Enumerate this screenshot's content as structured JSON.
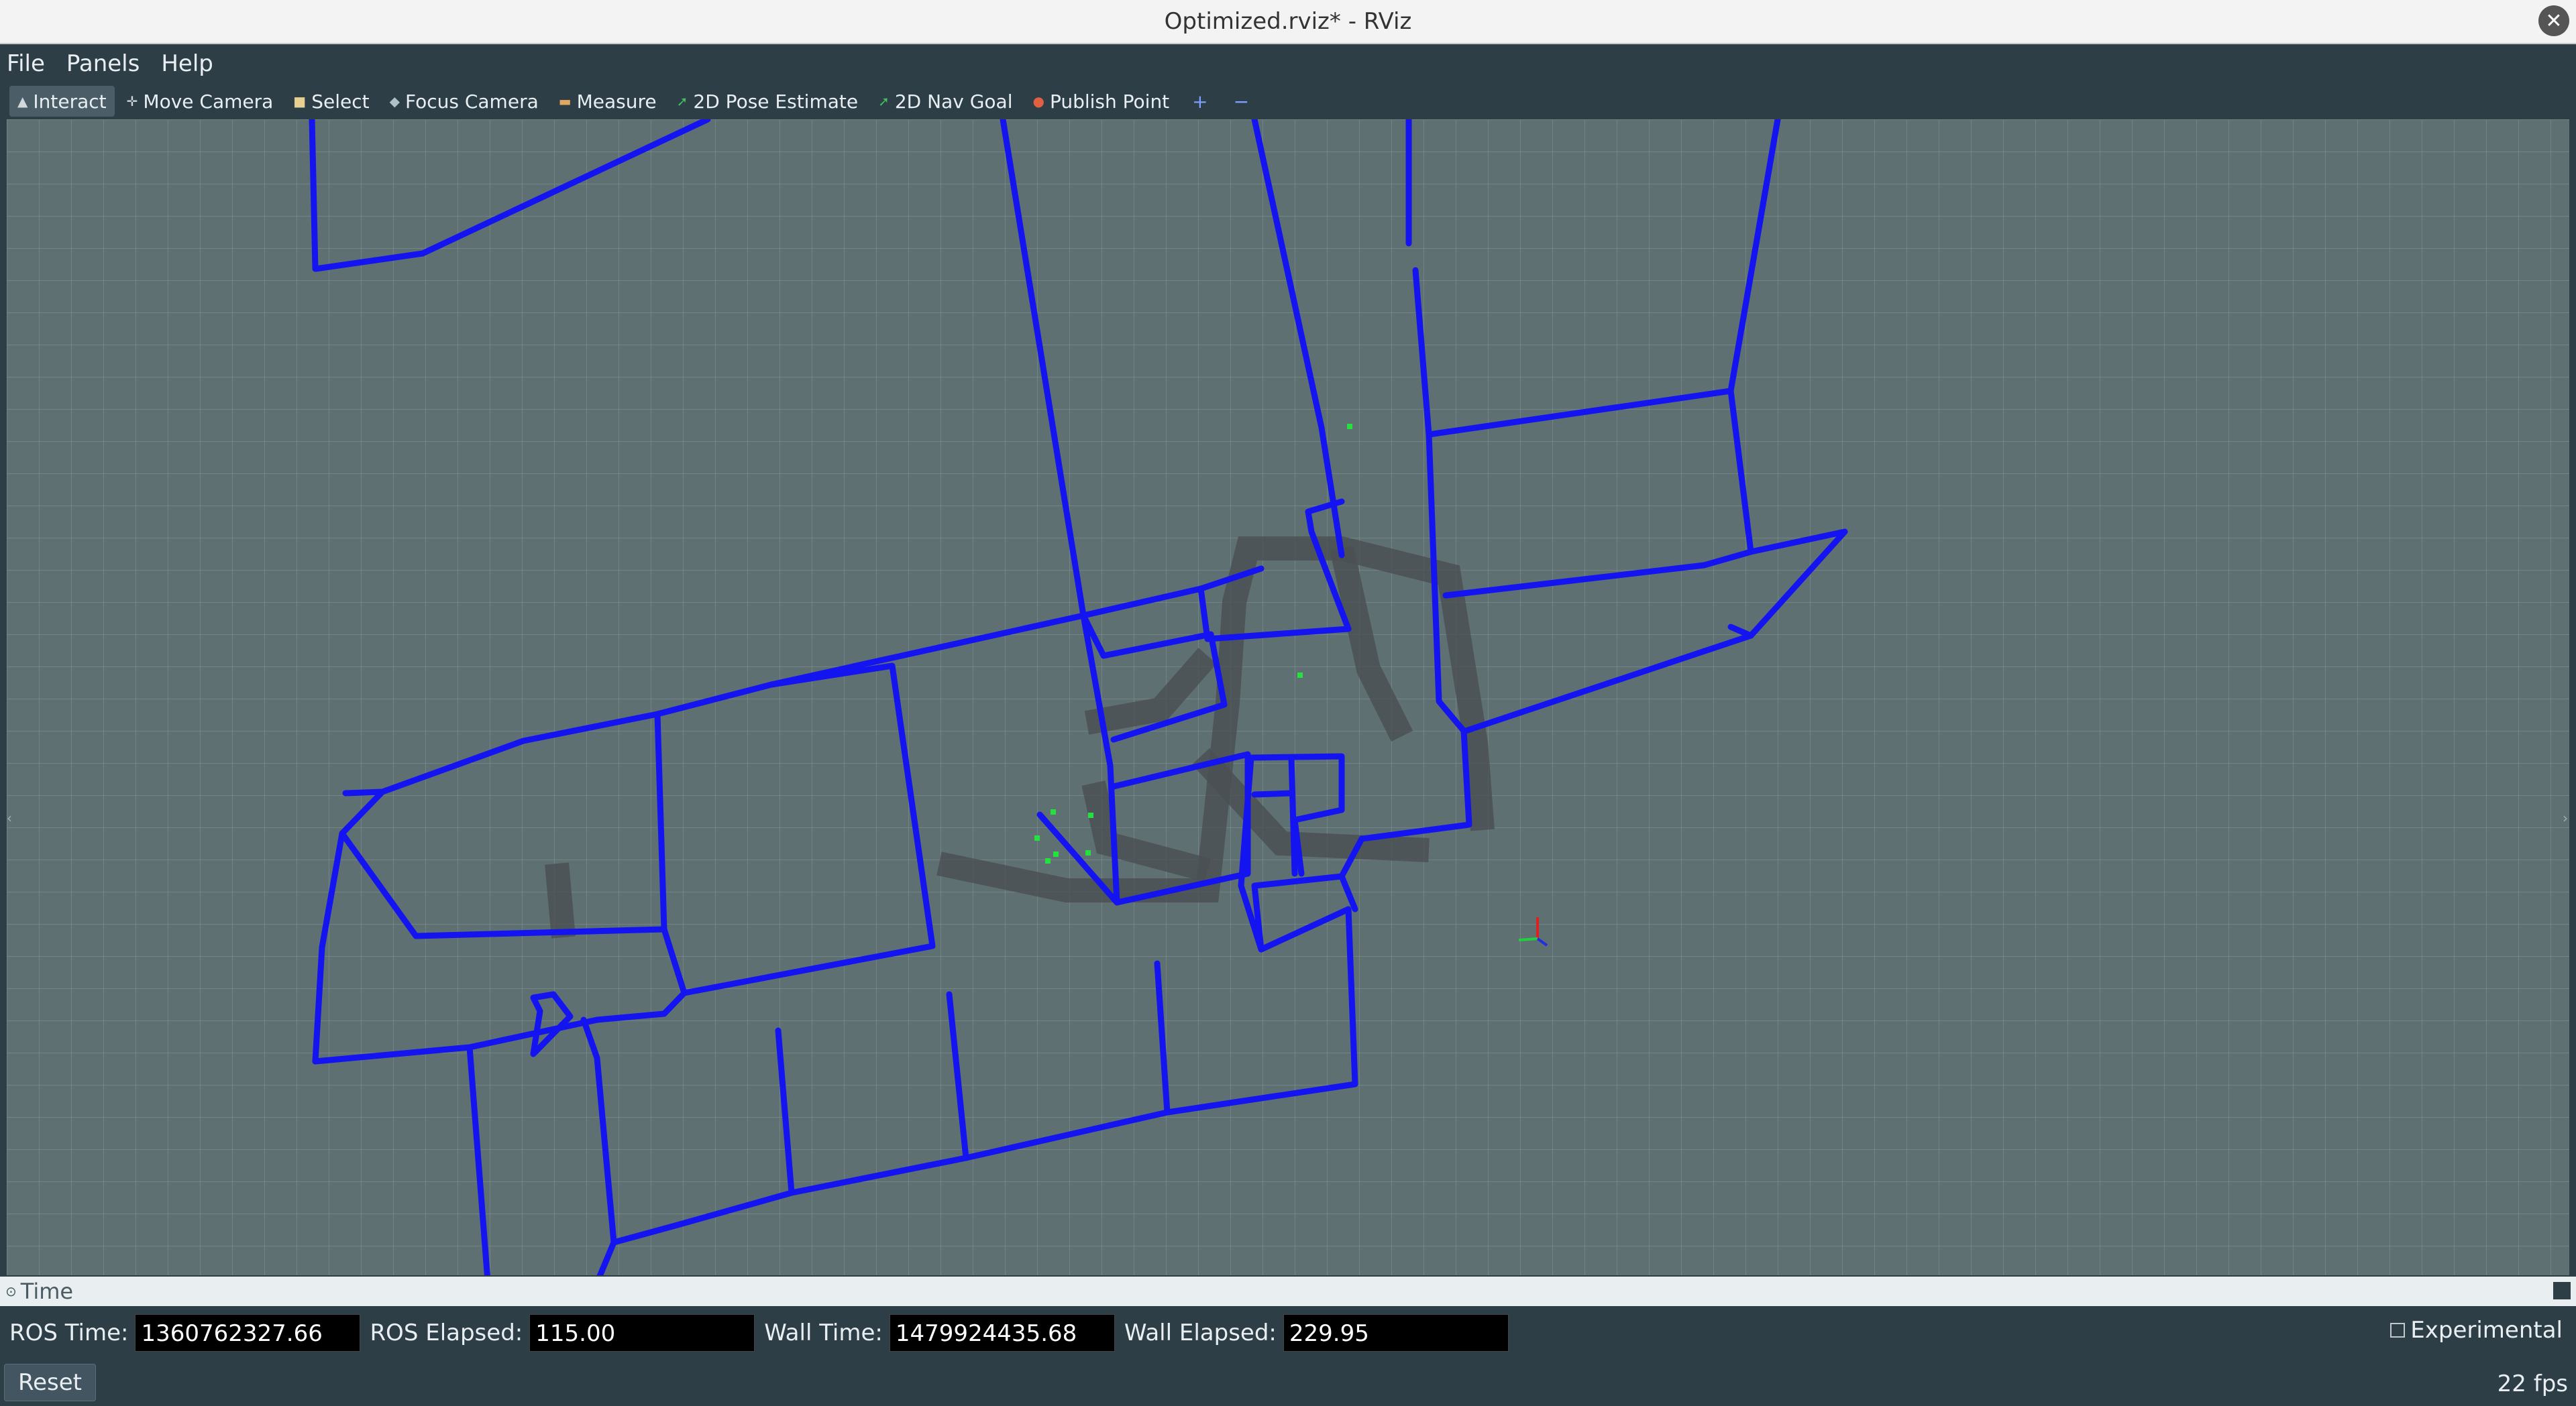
{
  "window": {
    "title": "Optimized.rviz* - RViz",
    "close_glyph": "✕"
  },
  "menu": [
    "File",
    "Panels",
    "Help"
  ],
  "toolbar": [
    {
      "label": "Interact",
      "icon": "interact-icon",
      "glyph": "▲",
      "color": "#d0d8dc",
      "active": true
    },
    {
      "label": "Move Camera",
      "icon": "move-camera-icon",
      "glyph": "✛",
      "color": "#d0d8dc"
    },
    {
      "label": "Select",
      "icon": "select-icon",
      "glyph": "■",
      "color": "#e8d090"
    },
    {
      "label": "Focus Camera",
      "icon": "focus-camera-icon",
      "glyph": "◆",
      "color": "#b0c0c8"
    },
    {
      "label": "Measure",
      "icon": "measure-icon",
      "glyph": "▬",
      "color": "#e0a860"
    },
    {
      "label": "2D Pose Estimate",
      "icon": "pose-estimate-icon",
      "glyph": "➚",
      "color": "#40c060"
    },
    {
      "label": "2D Nav Goal",
      "icon": "nav-goal-icon",
      "glyph": "➚",
      "color": "#40c060"
    },
    {
      "label": "Publish Point",
      "icon": "publish-point-icon",
      "glyph": "●",
      "color": "#e06040"
    }
  ],
  "toolbar_extra": {
    "add": "+",
    "remove": "−"
  },
  "colors": {
    "graph_edge": "#1414f0",
    "grid": "#788a8d",
    "viewport_bg": "#5f7073"
  },
  "time_panel": {
    "title": "Time",
    "ros_time_label": "ROS Time:",
    "ros_time": "1360762327.66",
    "ros_elapsed_label": "ROS Elapsed:",
    "ros_elapsed": "115.00",
    "wall_time_label": "Wall Time:",
    "wall_time": "1479924435.68",
    "wall_elapsed_label": "Wall Elapsed:",
    "wall_elapsed": "229.95",
    "experimental_label": "Experimental"
  },
  "bottom": {
    "reset_label": "Reset",
    "fps": "22 fps"
  }
}
